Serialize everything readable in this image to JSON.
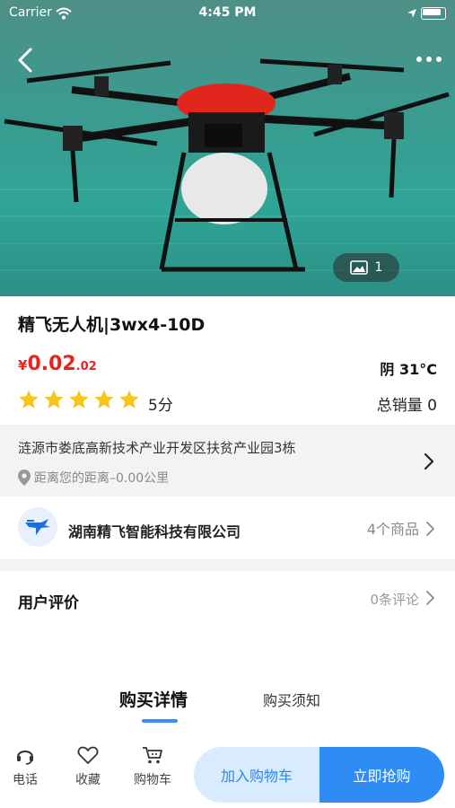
{
  "status_bar": {
    "carrier": "Carrier",
    "time": "4:45 PM"
  },
  "gallery": {
    "photo_count": "1"
  },
  "product": {
    "title": "精飞无人机|3wx4-10D",
    "price_symbol": "¥",
    "price_main": "0.02",
    "price_sub": ".02",
    "weather": "阴 31°C",
    "rating_stars": 5,
    "rating_label": "5分",
    "sales_label": "总销量 0"
  },
  "location": {
    "address": "涟源市娄底高新技术产业开发区扶贫产业园3栋",
    "distance": "距离您的距离–0.00公里"
  },
  "shop": {
    "name": "湖南精飞智能科技有限公司",
    "product_count": "4个商品"
  },
  "reviews": {
    "title": "用户评价",
    "count": "0条评论"
  },
  "tabs": [
    {
      "label": "购买详情",
      "active": true
    },
    {
      "label": "购买须知",
      "active": false
    }
  ],
  "bottom_bar": {
    "phone_label": "电话",
    "favorite_label": "收藏",
    "cart_label": "购物车",
    "add_to_cart": "加入购物车",
    "buy_now": "立即抢购"
  },
  "colors": {
    "price": "#e8241c",
    "accent": "#2f8cf5",
    "accent_light": "#d9ebff",
    "star": "#f5c518"
  }
}
